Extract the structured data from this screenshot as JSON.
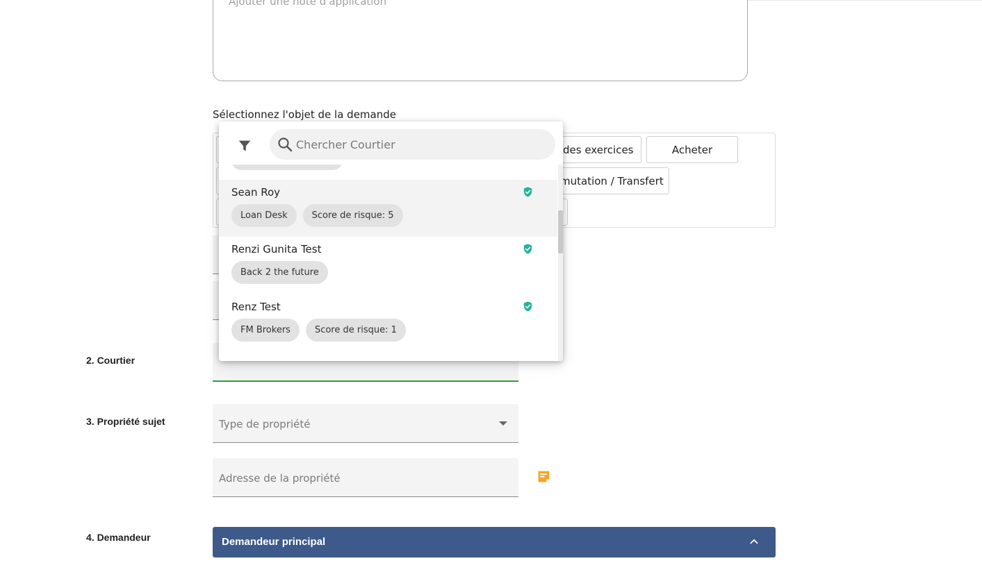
{
  "note": {
    "placeholder": "Ajouter une note d'application"
  },
  "purpose": {
    "label": "Sélectionnez l'objet de la demande",
    "buttons": [
      {
        "label": "des exercices"
      },
      {
        "label": "Acheter"
      },
      {
        "label": "mutation / Transfert"
      }
    ]
  },
  "sections": {
    "broker": "2. Courtier",
    "property": "3. Propriété sujet",
    "applicant": "4. Demandeur"
  },
  "property": {
    "type_placeholder": "Type de propriété",
    "address_placeholder": "Adresse de la propriété"
  },
  "applicant": {
    "panel_title": "Demandeur principal"
  },
  "broker_dropdown": {
    "search_placeholder": "Chercher Courtier",
    "items": [
      {
        "name": "Sean Roy",
        "chips": [
          "Loan Desk",
          "Score de risque: 5"
        ]
      },
      {
        "name": "Renzi Gunita Test",
        "chips": [
          "Back 2 the future"
        ]
      },
      {
        "name": "Renz Test",
        "chips": [
          "FM Brokers",
          "Score de risque: 1"
        ]
      }
    ]
  },
  "colors": {
    "accent_green": "#2e9e3a",
    "verified_teal": "#26b39a",
    "applicant_bar": "#3d5a8a",
    "note_icon_orange": "#f5a623"
  },
  "icons": {
    "filter": "filter-icon",
    "search": "search-icon",
    "verified": "shield-check-icon",
    "note": "sticky-note-icon",
    "collapse": "chevron-up-icon"
  }
}
